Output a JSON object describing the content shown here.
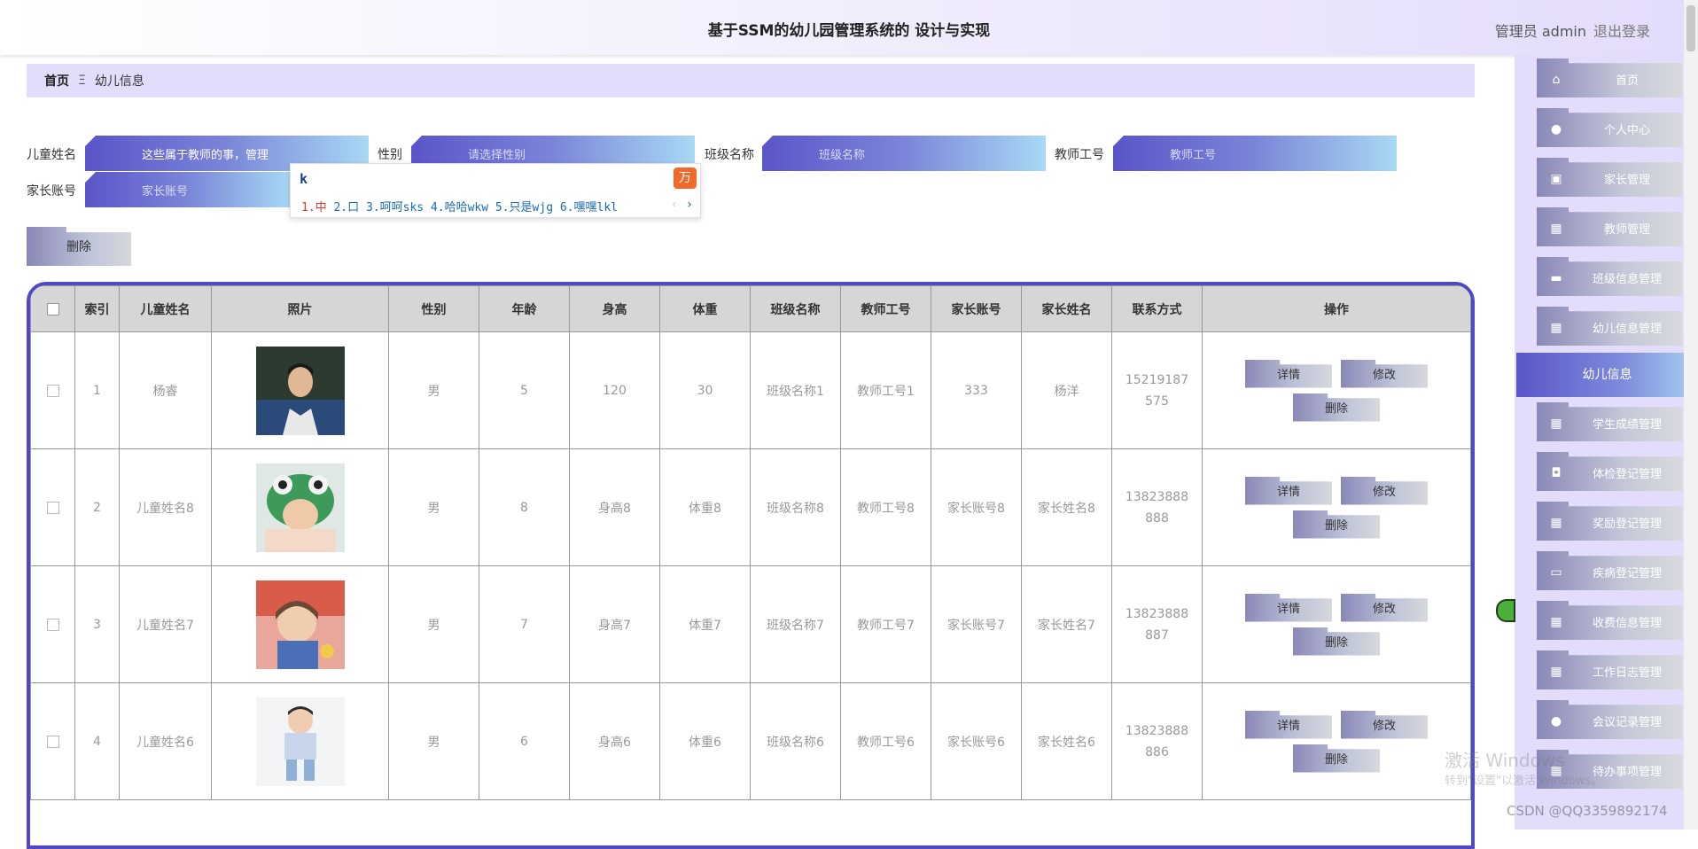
{
  "header": {
    "title": "基于SSM的幼儿园管理系统的 设计与实现",
    "user": "管理员 admin",
    "logout": "退出登录"
  },
  "breadcrumb": {
    "home": "首页",
    "separator": "Ξ",
    "current": "幼儿信息"
  },
  "search": {
    "child_name_label": "儿童姓名",
    "child_name_value": "这些属于教师的事，管理",
    "gender_label": "性别",
    "gender_placeholder": "请选择性别",
    "class_label": "班级名称",
    "class_placeholder": "班级名称",
    "teacher_id_label": "教师工号",
    "teacher_id_placeholder": "教师工号",
    "parent_account_label": "家长账号",
    "parent_account_placeholder": "家长账号"
  },
  "ime": {
    "composition": "k",
    "candidates_first": "1.中",
    "candidates_rest": " 2.口 3.呵呵sks 4.哈哈wkw 5.只是wjg 6.嘿嘿lkl"
  },
  "toolbar": {
    "delete_label": "删除"
  },
  "table": {
    "headers": [
      "",
      "索引",
      "儿童姓名",
      "照片",
      "性别",
      "年龄",
      "身高",
      "体重",
      "班级名称",
      "教师工号",
      "家长账号",
      "家长姓名",
      "联系方式",
      "操作"
    ],
    "rows": [
      {
        "index": "1",
        "name": "杨睿",
        "gender": "男",
        "age": "5",
        "height": "120",
        "weight": "30",
        "class": "班级名称1",
        "teacher": "教师工号1",
        "parent_account": "333",
        "parent_name": "杨洋",
        "phone": "15219187575"
      },
      {
        "index": "2",
        "name": "儿童姓名8",
        "gender": "男",
        "age": "8",
        "height": "身高8",
        "weight": "体重8",
        "class": "班级名称8",
        "teacher": "教师工号8",
        "parent_account": "家长账号8",
        "parent_name": "家长姓名8",
        "phone": "13823888888"
      },
      {
        "index": "3",
        "name": "儿童姓名7",
        "gender": "男",
        "age": "7",
        "height": "身高7",
        "weight": "体重7",
        "class": "班级名称7",
        "teacher": "教师工号7",
        "parent_account": "家长账号7",
        "parent_name": "家长姓名7",
        "phone": "13823888887"
      },
      {
        "index": "4",
        "name": "儿童姓名6",
        "gender": "男",
        "age": "6",
        "height": "身高6",
        "weight": "体重6",
        "class": "班级名称6",
        "teacher": "教师工号6",
        "parent_account": "家长账号6",
        "parent_name": "家长姓名6",
        "phone": "13823888886"
      }
    ],
    "actions": {
      "detail": "详情",
      "edit": "修改",
      "delete": "删除"
    }
  },
  "sidebar": {
    "items": [
      {
        "label": "首页",
        "icon": "home-icon"
      },
      {
        "label": "个人中心",
        "icon": "person-icon"
      },
      {
        "label": "家长管理",
        "icon": "clipboard-icon"
      },
      {
        "label": "教师管理",
        "icon": "grid-icon"
      },
      {
        "label": "班级信息管理",
        "icon": "ticket-icon"
      },
      {
        "label": "幼儿信息管理",
        "icon": "grid-icon"
      },
      {
        "label": "幼儿信息",
        "icon": "",
        "active": true
      },
      {
        "label": "学生成绩管理",
        "icon": "grid-icon"
      },
      {
        "label": "体检登记管理",
        "icon": "camera-icon"
      },
      {
        "label": "奖励登记管理",
        "icon": "grid-icon"
      },
      {
        "label": "疾病登记管理",
        "icon": "monitor-icon"
      },
      {
        "label": "收费信息管理",
        "icon": "grid-icon"
      },
      {
        "label": "工作日志管理",
        "icon": "grid-icon"
      },
      {
        "label": "会议记录管理",
        "icon": "person-icon"
      },
      {
        "label": "待办事项管理",
        "icon": "grid-icon"
      }
    ]
  },
  "overlay": {
    "watermark_title": "激活 Windows",
    "watermark_sub": "转到\"设置\"以激活 Windows。",
    "csdn": "CSDN @QQ3359892174"
  },
  "colors": {
    "accent": "#5049c4",
    "sidebar_bg": "#e4dcfb",
    "header_bg": "#d6d6d6"
  }
}
